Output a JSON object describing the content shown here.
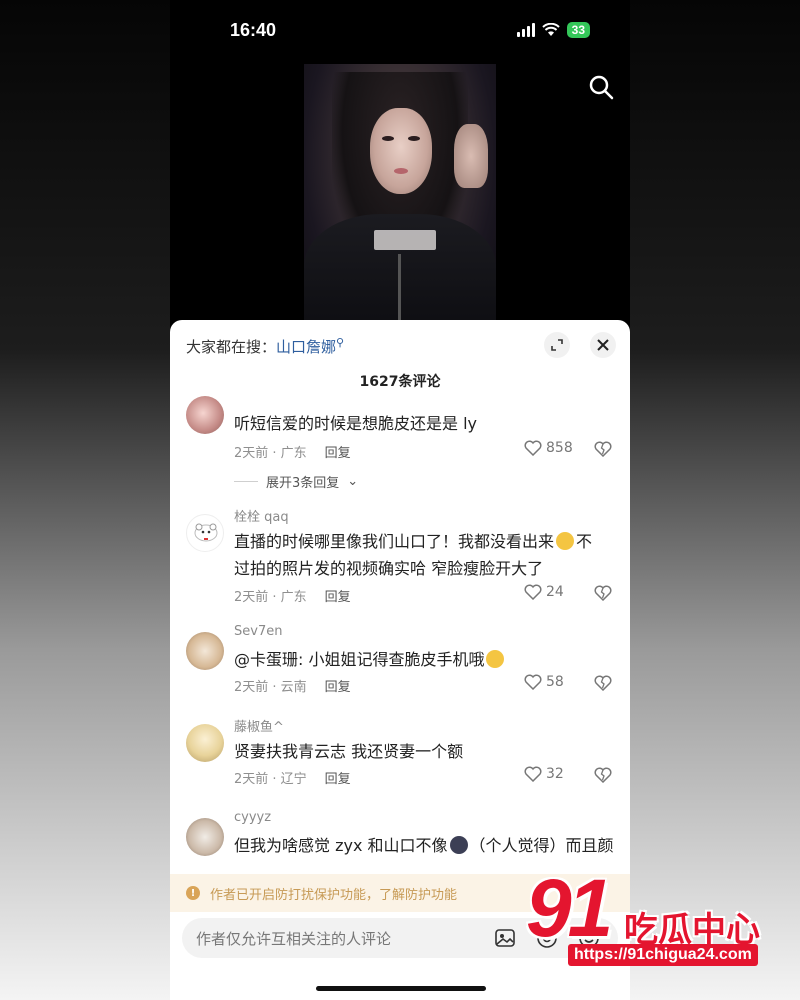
{
  "status": {
    "time": "16:40",
    "battery": "33"
  },
  "hot_search": {
    "prefix": "大家都在搜：",
    "keyword": "山口詹娜"
  },
  "comments_title": "1627条评论",
  "comments": [
    {
      "username": "",
      "text": "听短信爱的时候是想脆皮还是是 ly",
      "time_location": "2天前 · 广东",
      "reply": "回复",
      "likes": "858",
      "expand_replies": "展开3条回复"
    },
    {
      "username": "栓栓 qaq",
      "text_line1_a": "直播的时候哪里像我们山口了！我都没看出来",
      "text_line1_b": "不",
      "text_line2": "过拍的照片发的视频确实哈 窄脸瘦脸开大了",
      "time_location": "2天前 · 广东",
      "reply": "回复",
      "likes": "24"
    },
    {
      "username": "Sev7en",
      "text": "@卡蛋珊: 小姐姐记得查脆皮手机哦",
      "time_location": "2天前 · 云南",
      "reply": "回复",
      "likes": "58"
    },
    {
      "username": "藤椒鱼^",
      "text": "贤妻扶我青云志 我还贤妻一个额",
      "time_location": "2天前 · 辽宁",
      "reply": "回复",
      "likes": "32"
    },
    {
      "username": "cyyyz",
      "text_a": "但我为啥感觉 zyx 和山口不像",
      "text_b": "（个人觉得）而且颜"
    }
  ],
  "notice": "作者已开启防打扰保护功能，了解防护功能",
  "input_placeholder": "作者仅允许互相关注的人评论",
  "watermark": {
    "big": "91",
    "cn": "吃瓜中心",
    "url": "https://91chigua24.com"
  },
  "icons": {
    "search": "search-icon",
    "expand": "expand-icon",
    "close": "close-icon",
    "heart": "heart-icon",
    "broken_heart": "broken-heart-icon",
    "image": "image-icon",
    "at": "at-icon",
    "emoji": "emoji-icon"
  },
  "colors": {
    "accent_blue": "#2e5e9e",
    "notice_bg": "#fbf3e6",
    "notice_text": "#c79a55",
    "watermark_red": "#e4152f"
  }
}
